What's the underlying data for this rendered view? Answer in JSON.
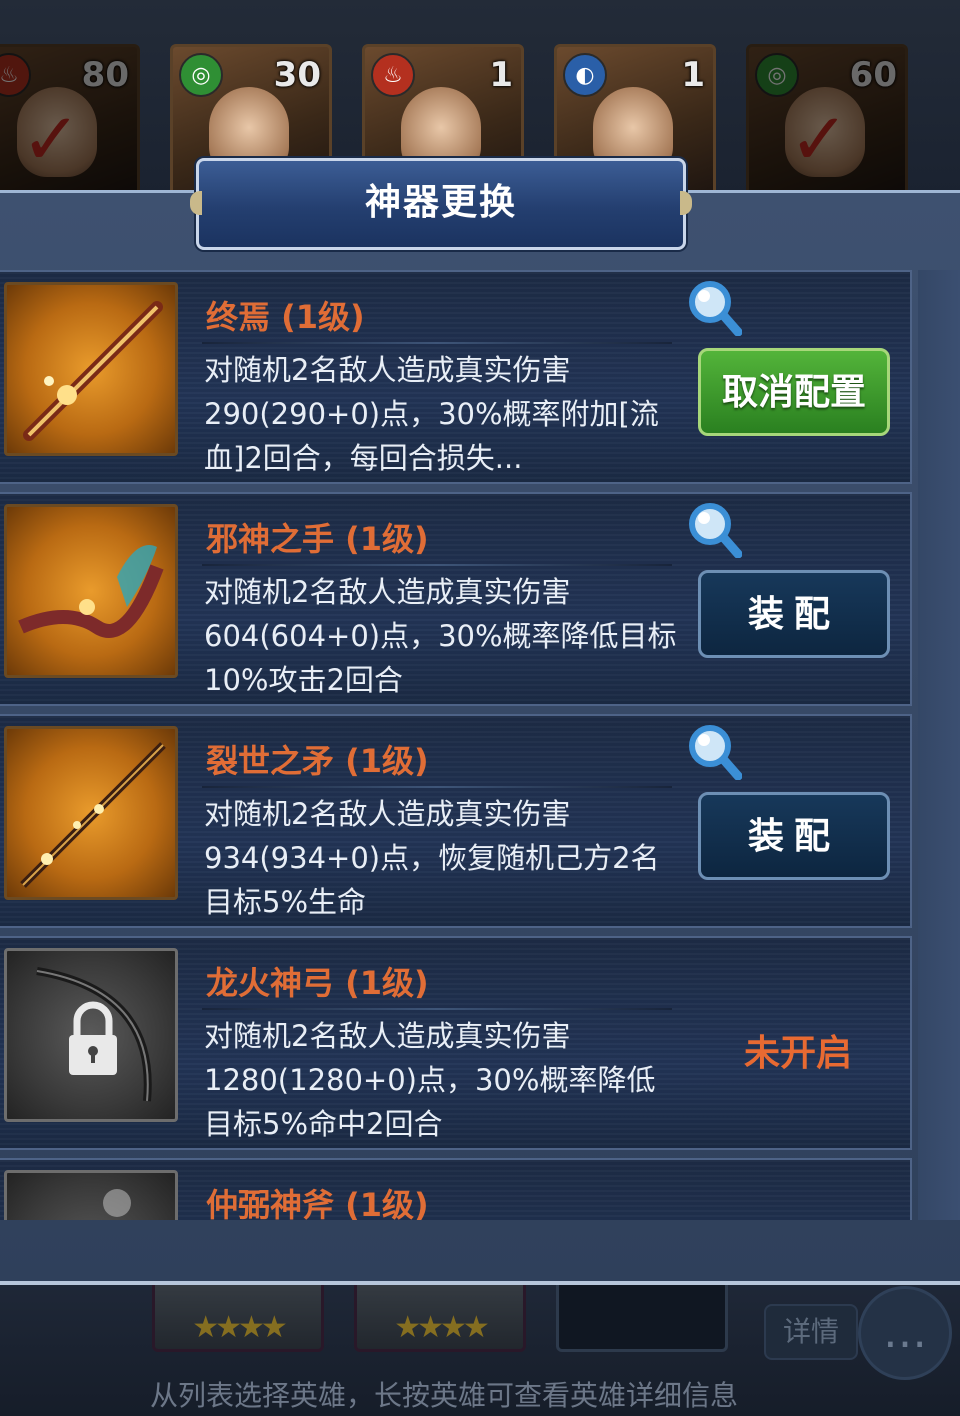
{
  "background": {
    "hero_cards": [
      {
        "level": "80",
        "element": "fire",
        "element_icon": "flame-icon",
        "selected": true
      },
      {
        "level": "30",
        "element": "wood",
        "element_icon": "leaf-icon",
        "selected": false
      },
      {
        "level": "1",
        "element": "fire",
        "element_icon": "flame-icon",
        "selected": false
      },
      {
        "level": "1",
        "element": "water",
        "element_icon": "water-icon",
        "selected": false
      },
      {
        "level": "60",
        "element": "wood",
        "element_icon": "leaf-icon",
        "selected": true
      }
    ],
    "detail_button": "详情",
    "hint": "从列表选择英雄，长按英雄可查看英雄详细信息"
  },
  "dialog": {
    "title": "神器更换",
    "artifacts": [
      {
        "name": "终焉 (1级)",
        "description": "对随机2名敌人造成真实伤害290(290+0)点，30%概率附加[流血]2回合，每回合损失...",
        "action": "取消配置",
        "action_type": "cancel",
        "icon": "sword-icon",
        "locked": false
      },
      {
        "name": "邪神之手 (1级)",
        "description": "对随机2名敌人造成真实伤害604(604+0)点，30%概率降低目标10%攻击2回合",
        "action": "装配",
        "action_type": "equip",
        "icon": "claw-icon",
        "locked": false
      },
      {
        "name": "裂世之矛 (1级)",
        "description": "对随机2名敌人造成真实伤害934(934+0)点，恢复随机己方2名目标5%生命",
        "action": "装配",
        "action_type": "equip",
        "icon": "spear-icon",
        "locked": false
      },
      {
        "name": "龙火神弓 (1级)",
        "description": "对随机2名敌人造成真实伤害1280(1280+0)点，30%概率降低目标5%命中2回合",
        "status": "未开启",
        "icon": "bow-icon",
        "locked": true
      },
      {
        "name": "仲弼神斧 (1级)",
        "description": "",
        "icon": "axe-icon",
        "locked": true
      }
    ]
  },
  "colors": {
    "artifact_name": "#e06d36",
    "locked_status": "#e86a32",
    "cancel_button": "#3e9a2c",
    "equip_button": "#14324f"
  }
}
